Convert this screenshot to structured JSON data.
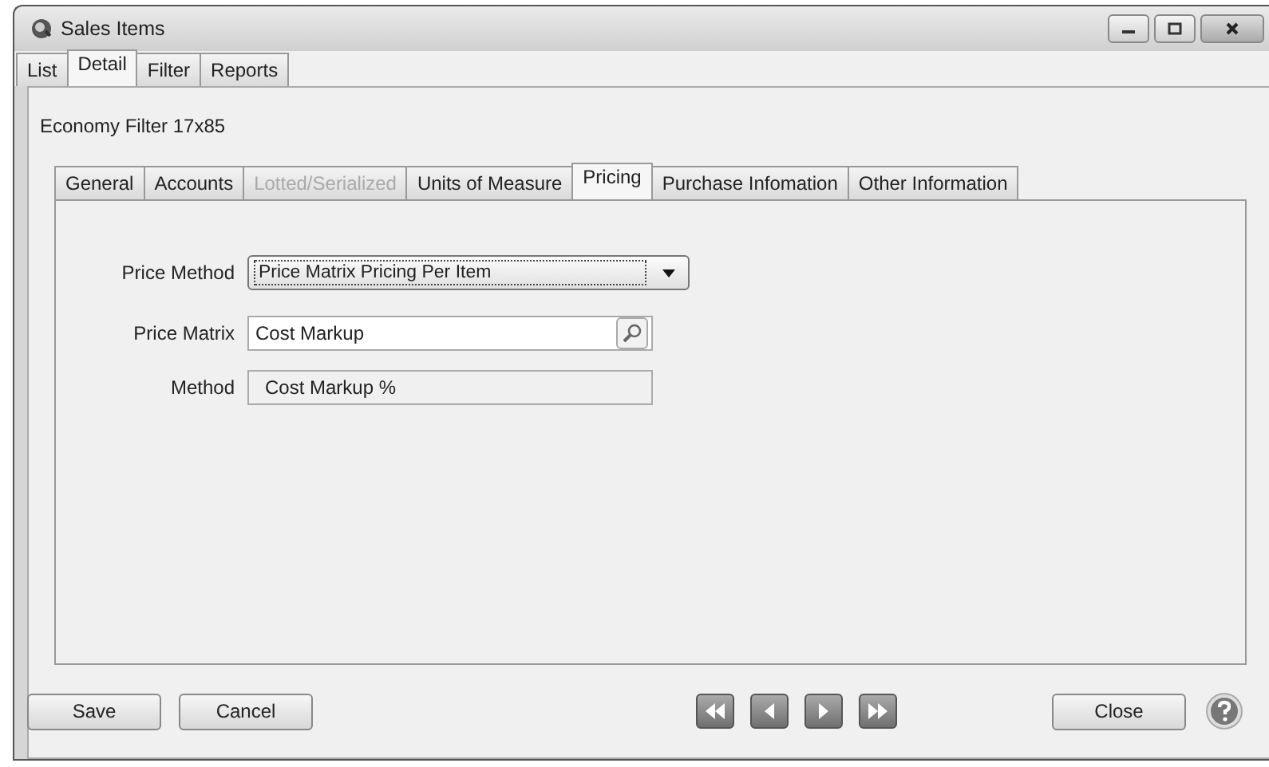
{
  "window": {
    "title": "Sales Items"
  },
  "tabs": [
    {
      "label": "List",
      "selected": false
    },
    {
      "label": "Detail",
      "selected": true
    },
    {
      "label": "Filter",
      "selected": false
    },
    {
      "label": "Reports",
      "selected": false
    }
  ],
  "item_name": "Economy Filter 17x85",
  "detail_tabs": [
    {
      "label": "General",
      "selected": false,
      "disabled": false
    },
    {
      "label": "Accounts",
      "selected": false,
      "disabled": false
    },
    {
      "label": "Lotted/Serialized",
      "selected": false,
      "disabled": true
    },
    {
      "label": "Units of Measure",
      "selected": false,
      "disabled": false
    },
    {
      "label": "Pricing",
      "selected": true,
      "disabled": false
    },
    {
      "label": "Purchase Infomation",
      "selected": false,
      "disabled": false
    },
    {
      "label": "Other Information",
      "selected": false,
      "disabled": false
    }
  ],
  "fields": [
    {
      "kind": "dropdown",
      "label": "Price Method",
      "value": "Price Matrix Pricing Per Item"
    },
    {
      "kind": "lookup",
      "label": "Price Matrix",
      "value": "Cost Markup"
    },
    {
      "kind": "readonly",
      "label": "Method",
      "value": "Cost Markup %"
    }
  ],
  "buttons": {
    "left": [
      "Save",
      "Cancel"
    ],
    "right": [
      "Close"
    ]
  }
}
